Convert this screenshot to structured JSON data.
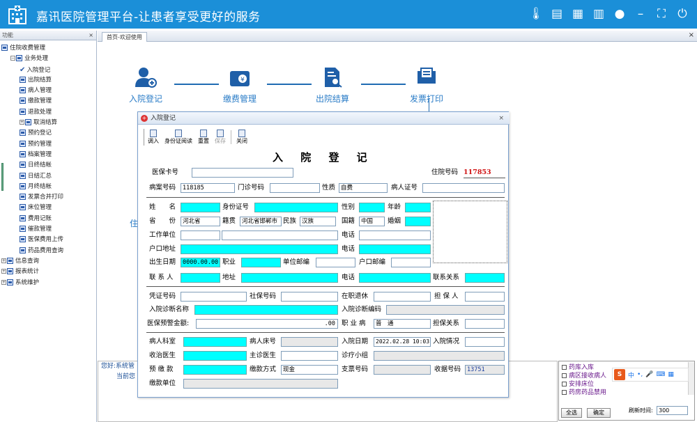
{
  "header": {
    "title": "嘉讯医院管理平台-让患者享受更好的服务"
  },
  "left": {
    "panel_title": "功能",
    "close": "×",
    "tree": [
      {
        "label": "住院收费管理",
        "level": 0,
        "pm": ""
      },
      {
        "label": "业务处理",
        "level": 1,
        "pm": "−"
      },
      {
        "label": "入院登记",
        "level": 2,
        "check": true
      },
      {
        "label": "出院结算",
        "level": 2
      },
      {
        "label": "病人管理",
        "level": 2
      },
      {
        "label": "缴款管理",
        "level": 2
      },
      {
        "label": "退款处理",
        "level": 2
      },
      {
        "label": "取消结算",
        "level": 2,
        "pm": "+"
      },
      {
        "label": "预约登记",
        "level": 2
      },
      {
        "label": "预约管理",
        "level": 2
      },
      {
        "label": "档案管理",
        "level": 2
      },
      {
        "label": "日终结帐",
        "level": 2
      },
      {
        "label": "日结汇总",
        "level": 2
      },
      {
        "label": "月终结帐",
        "level": 2
      },
      {
        "label": "发票合并打印",
        "level": 2
      },
      {
        "label": "床位管理",
        "level": 2
      },
      {
        "label": "费用记账",
        "level": 2
      },
      {
        "label": "催款管理",
        "level": 2
      },
      {
        "label": "医保费用上传",
        "level": 2
      },
      {
        "label": "药品费用查询",
        "level": 2
      },
      {
        "label": "信息查询",
        "level": 0,
        "pm": "+"
      },
      {
        "label": "报表统计",
        "level": 0,
        "pm": "+"
      },
      {
        "label": "系统维护",
        "level": 0,
        "pm": "+"
      }
    ]
  },
  "tabs": {
    "active": "首页-欢迎使用",
    "close": "×"
  },
  "flow": {
    "steps": [
      "入院登记",
      "缴费管理",
      "出院结算",
      "发票打印"
    ],
    "hidden_label": "住"
  },
  "dialog": {
    "title": "入院登记",
    "close": "×",
    "toolbar": [
      "调入",
      "身份证阅读",
      "重置",
      "保存",
      "关闭"
    ],
    "heading": "入 院 登 记",
    "labels": {
      "yibao_card": "医保卡号",
      "zhuyuan_no": "住院号码",
      "bingan_no": "病案号码",
      "menzhen_no": "门诊号码",
      "xingshi": "性质",
      "patient_id": "病人证号",
      "name": "姓　　名",
      "idcard": "身份证号",
      "gender": "性别",
      "age": "年龄",
      "province": "省　　份",
      "jiguan": "籍贯",
      "minzu": "民族",
      "guoji": "国籍",
      "hunyin": "婚姻",
      "work": "工作单位",
      "phone": "电话",
      "hukou": "户口地址",
      "phone2": "电话",
      "birthday": "出生日期",
      "job": "职业",
      "unit_zip": "单位邮编",
      "hukou_zip": "户口邮编",
      "contact": "联 系 人",
      "address": "地址",
      "phone3": "电话",
      "relation": "联系关系",
      "pingzheng": "凭证号码",
      "shebao": "社保号码",
      "zaizhi": "在职退休",
      "danbao": "担 保 人",
      "diag_name": "入院诊断名称",
      "diag_code": "入院诊断编码",
      "yujing": "医保预警金额:",
      "zhiye_bing": "职 业 病",
      "danbao_rel": "担保关系",
      "dept": "病人科室",
      "bed": "病人床号",
      "admit_date": "入院日期",
      "admit_status": "入院情况",
      "doctor": "收治医生",
      "chief": "主诊医生",
      "diag_small": "诊疗小组",
      "deposit": "预 缴 款",
      "pay_method": "缴款方式",
      "check_no": "支票号码",
      "receipt": "收据号码",
      "pay_unit": "缴款单位"
    },
    "values": {
      "zhuyuan_no": "117853",
      "bingan_no": "118185",
      "xingshi": "自费",
      "province": "河北省",
      "jiguan": "河北省邯郸市",
      "minzu": "汉族",
      "guoji": "中国",
      "birthday": "0000.00.00",
      "yujing": ".00",
      "zhiye_bing": "普　通",
      "admit_date": "2022.02.28 10:03",
      "pay_method": "现金",
      "receipt": "13751"
    }
  },
  "bottom": {
    "msg1": "您好:系统管",
    "msg2": "当前您"
  },
  "right_panel": {
    "items": [
      "药库入库",
      "病区接收病人",
      "安排床位",
      "药房药品禁用"
    ],
    "btn_all": "全选",
    "btn_ok": "确定",
    "refresh_label": "刷新时间:",
    "refresh_value": "300"
  },
  "ime": {
    "logo": "S",
    "label": "中"
  }
}
